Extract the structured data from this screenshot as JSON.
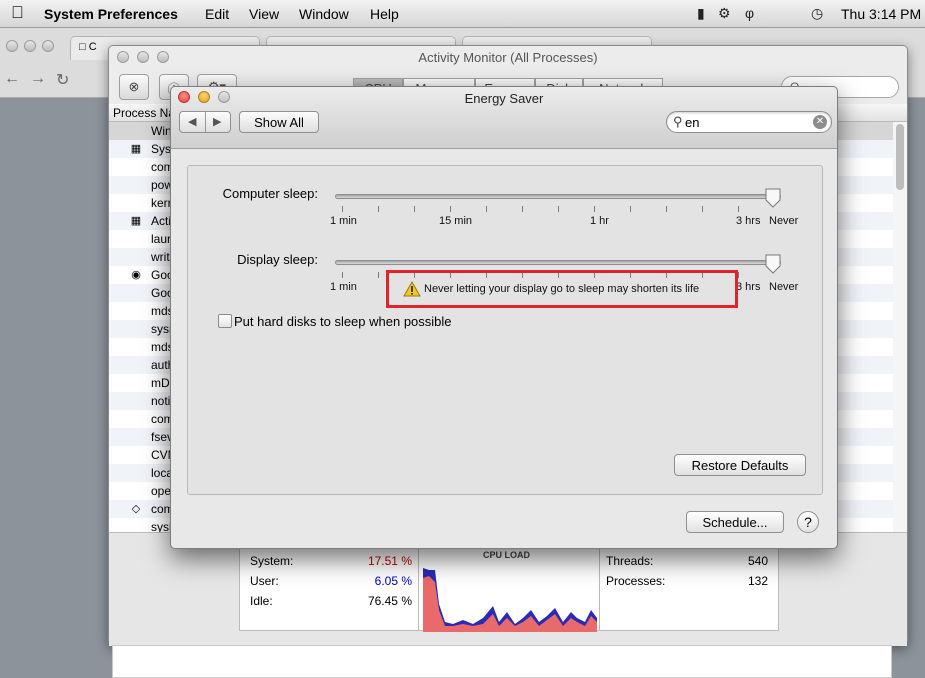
{
  "menubar": {
    "app_name": "System Preferences",
    "items": [
      "Edit",
      "View",
      "Window",
      "Help"
    ],
    "clock": "Thu 3:14 PM"
  },
  "browser": {
    "tab1_label": "C"
  },
  "activity_monitor": {
    "title": "Activity Monitor (All Processes)",
    "segments": [
      "CPU",
      "Memory",
      "Energy",
      "Disk",
      "Network"
    ],
    "search_placeholder": "Q~",
    "column_process": "Process Na",
    "processes": [
      "Win",
      "Syst",
      "com",
      "pow",
      "kerr",
      "Acti",
      "laur",
      "writ",
      "Goo",
      "Goo",
      "mds",
      "sysr",
      "mds",
      "auth",
      "mD",
      "noti",
      "com",
      "fsev",
      "CVM",
      "loca",
      "ope",
      "com",
      "sysl"
    ],
    "stats": {
      "system_label": "System:",
      "system_value": "17.51 %",
      "system_color": "#c00000",
      "user_label": "User:",
      "user_value": "6.05 %",
      "user_color": "#0000cc",
      "idle_label": "Idle:",
      "idle_value": "76.45 %",
      "cpu_load_title": "CPU LOAD",
      "threads_label": "Threads:",
      "threads_value": "540",
      "processes_label": "Processes:",
      "processes_value": "132"
    }
  },
  "energy_saver": {
    "title": "Energy Saver",
    "show_all_label": "Show All",
    "search_value": "en",
    "computer_sleep_label": "Computer sleep:",
    "display_sleep_label": "Display sleep:",
    "tick_labels_computer": [
      "1 min",
      "15 min",
      "1 hr",
      "3 hrs",
      "Never"
    ],
    "tick_labels_display": [
      "1 min",
      "3 hrs",
      "Never"
    ],
    "computer_sleep_value": "Never",
    "display_sleep_value": "Never",
    "warning_text": "Never letting your display go to sleep may shorten its life",
    "disk_sleep_label": "Put hard disks to sleep when possible",
    "disk_sleep_checked": false,
    "restore_defaults_label": "Restore Defaults",
    "schedule_label": "Schedule...",
    "help_label": "?"
  },
  "colors": {
    "warning_border": "#e1232b",
    "cpu_system": "#e05050",
    "cpu_user": "#2020c0"
  }
}
